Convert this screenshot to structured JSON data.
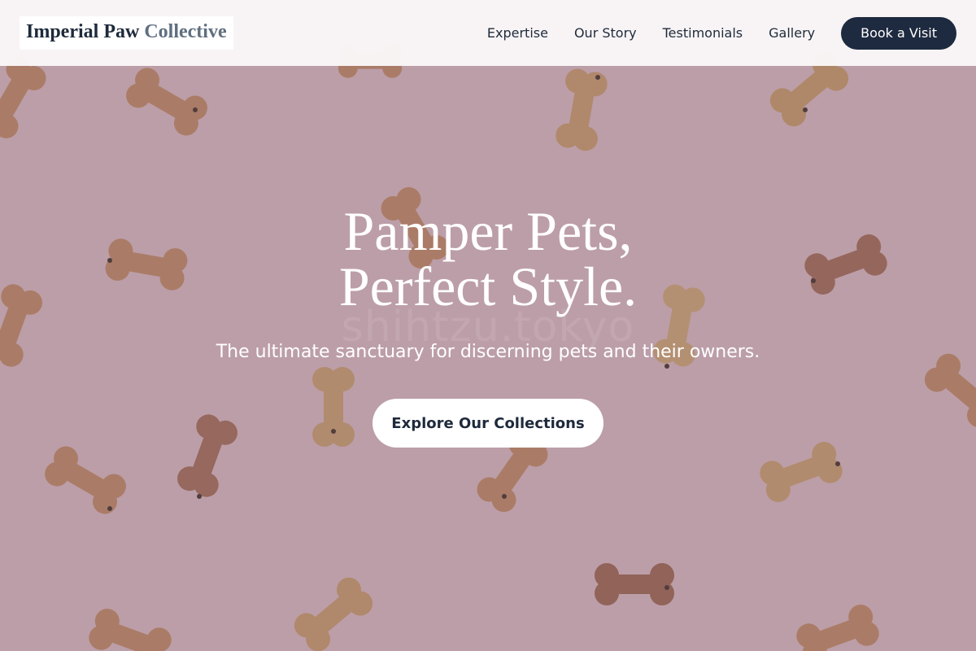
{
  "brand": {
    "name_primary": "Imperial Paw",
    "name_accent": "Collective"
  },
  "nav": {
    "items": [
      {
        "label": "Expertise"
      },
      {
        "label": "Our Story"
      },
      {
        "label": "Testimonials"
      },
      {
        "label": "Gallery"
      }
    ],
    "cta_label": "Book a Visit"
  },
  "hero": {
    "title_line1": "Pamper Pets,",
    "title_line2": "Perfect Style.",
    "subtitle": "The ultimate sanctuary for discerning pets and their owners.",
    "cta_label": "Explore Our Collections",
    "watermark": "shihtzu.tokyo",
    "background_icon": "dog-bone-treats-photo"
  },
  "colors": {
    "navy": "#1e2a3f",
    "header_bg": "#faf7f8",
    "hero_bg": "#e6c7cf",
    "text_light": "#ffffff"
  }
}
